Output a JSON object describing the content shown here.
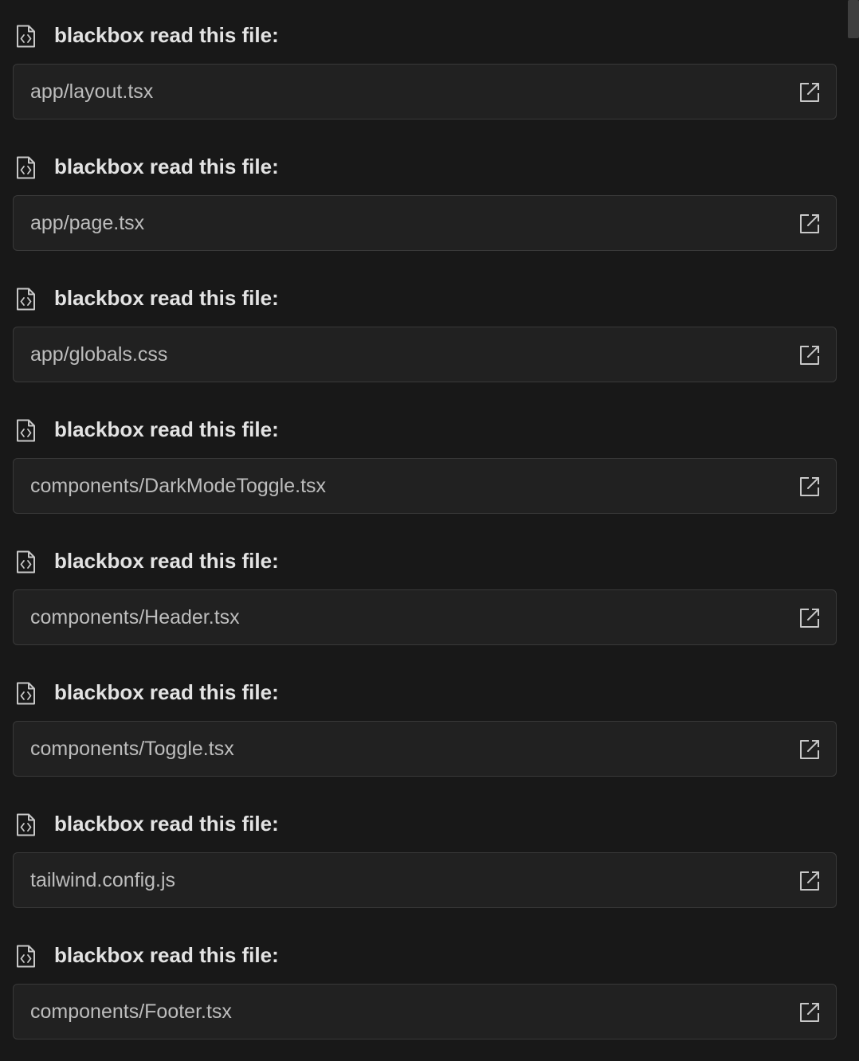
{
  "entries": [
    {
      "header": "blackbox read this file:",
      "path": "app/layout.tsx"
    },
    {
      "header": "blackbox read this file:",
      "path": "app/page.tsx"
    },
    {
      "header": "blackbox read this file:",
      "path": "app/globals.css"
    },
    {
      "header": "blackbox read this file:",
      "path": "components/DarkModeToggle.tsx"
    },
    {
      "header": "blackbox read this file:",
      "path": "components/Header.tsx"
    },
    {
      "header": "blackbox read this file:",
      "path": "components/Toggle.tsx"
    },
    {
      "header": "blackbox read this file:",
      "path": "tailwind.config.js"
    },
    {
      "header": "blackbox read this file:",
      "path": "components/Footer.tsx"
    }
  ],
  "icons": {
    "header_icon": "file-code-icon",
    "card_icon": "external-link-icon"
  },
  "colors": {
    "background": "#181818",
    "card_background": "#212121",
    "card_border": "#393939",
    "header_text": "#e3e3e3",
    "path_text": "#bdbdbd",
    "icon": "#c8c8c8"
  }
}
